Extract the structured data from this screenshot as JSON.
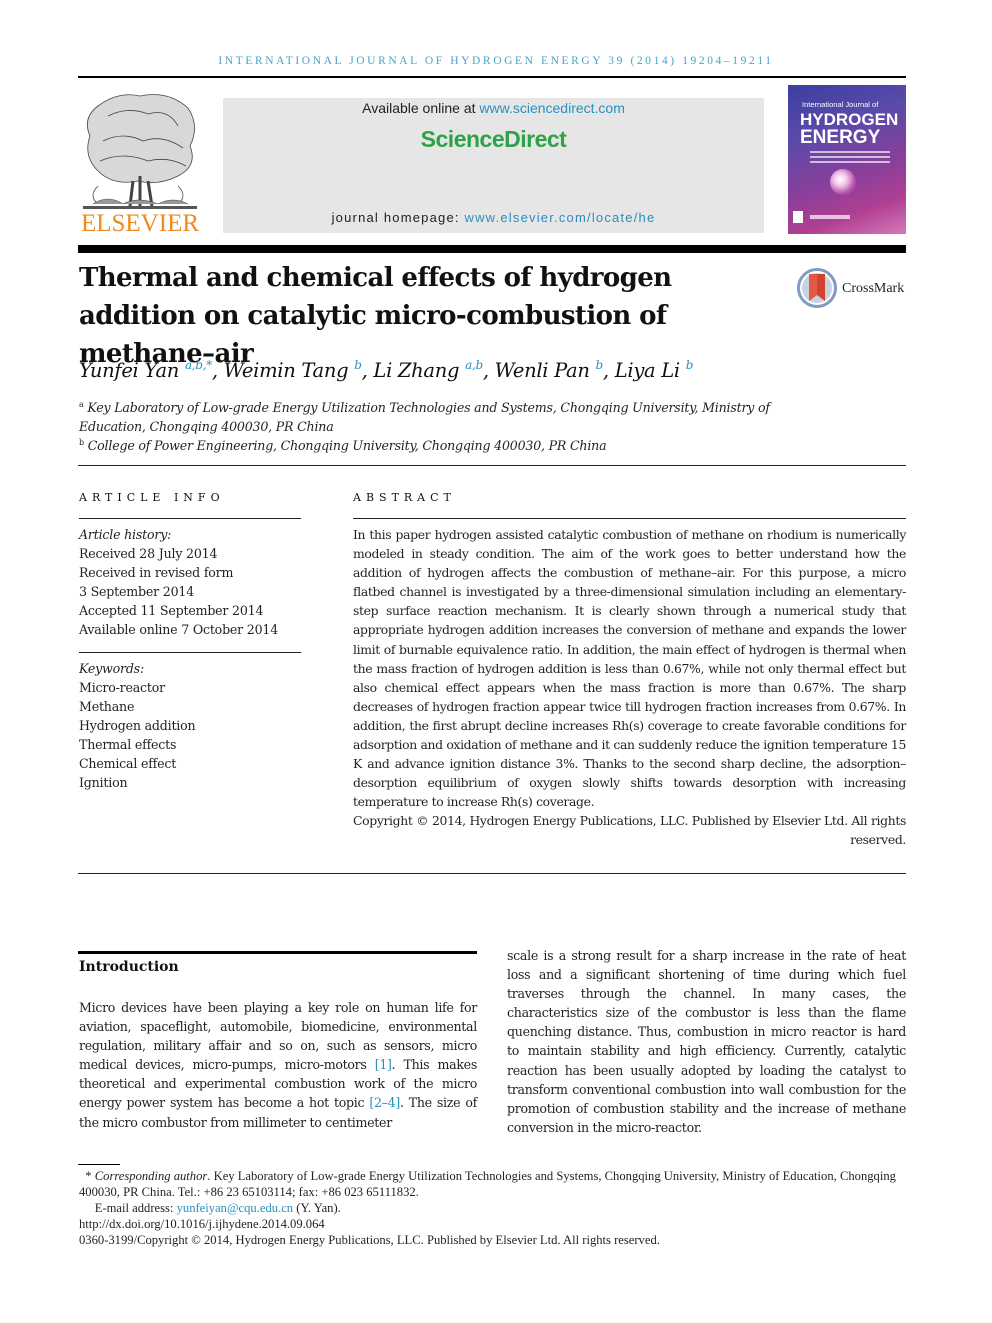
{
  "running_header": "International Journal of Hydrogen Energy 39 (2014) 19204–19211",
  "publisher": {
    "logo_icon": "elsevier-tree-icon",
    "wordmark": "ELSEVIER"
  },
  "sciencedirect": {
    "available_prefix": "Available online at ",
    "available_link": "www.sciencedirect.com",
    "brand": "ScienceDirect",
    "homepage_prefix": "journal homepage: ",
    "homepage_link": "www.elsevier.com/locate/he"
  },
  "cover": {
    "line1": "International Journal of",
    "line2": "HYDROGEN",
    "line3": "ENERGY"
  },
  "title": "Thermal and chemical effects of hydrogen addition on catalytic micro-combustion of methane–air",
  "crossmark": {
    "icon": "crossmark-icon",
    "label": "CrossMark"
  },
  "authors": [
    {
      "name": "Yunfei Yan",
      "sup": "a,b,*",
      "sep": ", "
    },
    {
      "name": "Weimin Tang",
      "sup": "b",
      "sep": ", "
    },
    {
      "name": "Li Zhang",
      "sup": "a,b",
      "sep": ", "
    },
    {
      "name": "Wenli Pan",
      "sup": "b",
      "sep": ", "
    },
    {
      "name": "Liya Li",
      "sup": "b",
      "sep": ""
    }
  ],
  "affiliations": [
    {
      "mark": "a",
      "text": "Key Laboratory of Low-grade Energy Utilization Technologies and Systems, Chongqing University, Ministry of Education, Chongqing 400030, PR China"
    },
    {
      "mark": "b",
      "text": "College of Power Engineering, Chongqing University, Chongqing 400030, PR China"
    }
  ],
  "article_info": {
    "heading": "ARTICLE INFO",
    "history_label": "Article history:",
    "history": [
      "Received 28 July 2014",
      "Received in revised form",
      "3 September 2014",
      "Accepted 11 September 2014",
      "Available online 7 October 2014"
    ],
    "keywords_label": "Keywords:",
    "keywords": [
      "Micro-reactor",
      "Methane",
      "Hydrogen addition",
      "Thermal effects",
      "Chemical effect",
      "Ignition"
    ]
  },
  "abstract": {
    "heading": "ABSTRACT",
    "text": "In this paper hydrogen assisted catalytic combustion of methane on rhodium is numerically modeled in steady condition. The aim of the work goes to better understand how the addition of hydrogen affects the combustion of methane–air. For this purpose, a micro flatbed channel is investigated by a three-dimensional simulation including an elementary-step surface reaction mechanism. It is clearly shown through a numerical study that appropriate hydrogen addition increases the conversion of methane and expands the lower limit of burnable equivalence ratio. In addition, the main effect of hydrogen is thermal when the mass fraction of hydrogen addition is less than 0.67%, while not only thermal effect but also chemical effect appears when the mass fraction is more than 0.67%. The sharp decreases of hydrogen fraction appear twice till hydrogen fraction increases from 0.67%. In addition, the first abrupt decline increases Rh(s) coverage to create favorable conditions for adsorption and oxidation of methane and it can suddenly reduce the ignition temperature 15 K and advance ignition distance 3%. Thanks to the second sharp decline, the adsorption–desorption equilibrium of oxygen slowly shifts towards desorption with increasing temperature to increase Rh(s) coverage.",
    "copyright": "Copyright © 2014, Hydrogen Energy Publications, LLC. Published by Elsevier Ltd. All rights reserved."
  },
  "introduction": {
    "heading": "Introduction",
    "left_part1": "Micro devices have been playing a key role on human life for aviation, spaceflight, automobile, biomedicine, environmental regulation, military affair and so on, such as sensors, micro medical devices, micro-pumps, micro-motors ",
    "ref1": "[1]",
    "left_part2": ". This makes theoretical and experimental combustion work of the micro energy power system has become a hot topic ",
    "ref2": "[2–4]",
    "left_part3": ". The size of the micro combustor from millimeter to centimeter",
    "right_text": "scale is a strong result for a sharp increase in the rate of heat loss and a significant shortening of time during which fuel traverses through the channel. In many cases, the characteristics size of the combustor is less than the flame quenching distance. Thus, combustion in micro reactor is hard to maintain stability and high efficiency. Currently, catalytic reaction has been usually adopted by loading the catalyst to transform conventional combustion into wall combustion for the promotion of combustion stability and the increase of methane conversion in the micro-reactor."
  },
  "footnotes": {
    "corr_mark": "* ",
    "corr_label": "Corresponding author",
    "corr_text": ". Key Laboratory of Low-grade Energy Utilization Technologies and Systems, Chongqing University, Ministry of Education, Chongqing 400030, PR China. Tel.: +86 23 65103114; fax: +86 023 65111832.",
    "email_label": "E-mail address: ",
    "email": "yunfeiyan@cqu.edu.cn",
    "email_suffix": " (Y. Yan).",
    "doi": "http://dx.doi.org/10.1016/j.ijhydene.2014.09.064",
    "issn_line": "0360-3199/Copyright © 2014, Hydrogen Energy Publications, LLC. Published by Elsevier Ltd. All rights reserved."
  },
  "colors": {
    "link": "#2a8fbd",
    "sciencedirect_green": "#2fa249",
    "elsevier_orange": "#f08a1c",
    "header_band": "#e6e6e6"
  }
}
